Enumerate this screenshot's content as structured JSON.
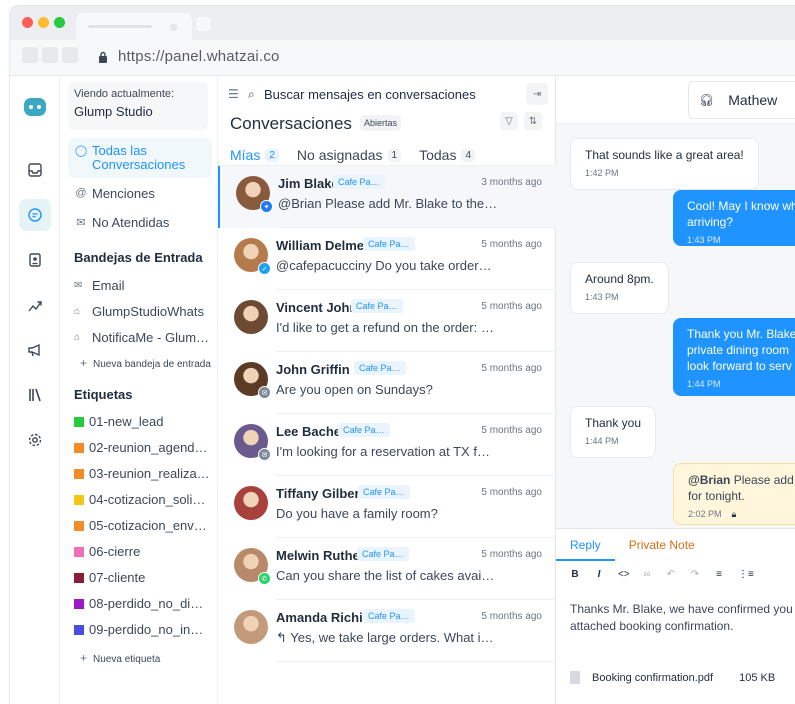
{
  "browser": {
    "url": "https://panel.whatzai.co"
  },
  "sidebar": {
    "viewing_label": "Viendo actualmente:",
    "viewing_value": "Glump Studio",
    "nav": [
      {
        "label": "Todas las Conversaciones",
        "icon": "chat-icon"
      },
      {
        "label": "Menciones",
        "icon": "at-icon"
      },
      {
        "label": "No Atendidas",
        "icon": "envelope-icon"
      }
    ],
    "inboxes_title": "Bandejas de Entrada",
    "inboxes": [
      {
        "label": "Email",
        "icon": "mail-icon"
      },
      {
        "label": "GlumpStudioWhats",
        "icon": "inbox-icon"
      },
      {
        "label": "NotificaMe - Glum…",
        "icon": "inbox-icon"
      }
    ],
    "new_inbox": "Nueva bandeja de entrada",
    "labels_title": "Etiquetas",
    "labels": [
      {
        "label": "01-new_lead",
        "color": "#27c93f"
      },
      {
        "label": "02-reunion_agend…",
        "color": "#f28c28"
      },
      {
        "label": "03-reunion_realiza…",
        "color": "#f28c28"
      },
      {
        "label": "04-cotizacion_soli…",
        "color": "#f5c518"
      },
      {
        "label": "05-cotizacion_env…",
        "color": "#f28c28"
      },
      {
        "label": "06-cierre",
        "color": "#f06eb7"
      },
      {
        "label": "07-cliente",
        "color": "#8b1c3a"
      },
      {
        "label": "08-perdido_no_di…",
        "color": "#9b19c9"
      },
      {
        "label": "09-perdido_no_in…",
        "color": "#4a4de0"
      }
    ],
    "new_label": "Nueva etiqueta"
  },
  "list": {
    "search_placeholder": "Buscar mensajes en conversaciones",
    "title": "Conversaciones",
    "status": "Abiertas",
    "tabs": [
      {
        "label": "Mías",
        "count": "2"
      },
      {
        "label": "No asignadas",
        "count": "1"
      },
      {
        "label": "Todas",
        "count": "4"
      }
    ],
    "conversations": [
      {
        "name": "Jim Blake",
        "tag": "Cafe Pa…",
        "time": "3 months ago",
        "message": "@Brian Please add Mr. Blake to the gu…",
        "channel_icon": "messenger-icon",
        "avatar_color": "#8a5a3c",
        "channel_color": "#1f7cf2"
      },
      {
        "name": "William Delmer",
        "tag": "Cafe Pa…",
        "time": "5 months ago",
        "message": "@cafepacucciny Do you take orders vi…",
        "channel_icon": "twitter-icon",
        "avatar_color": "#b57b4c",
        "channel_color": "#1da1f2"
      },
      {
        "name": "Vincent John",
        "tag": "Cafe Pa…",
        "time": "5 months ago",
        "message": "I'd like to get a refund on the order: 12…",
        "channel_icon": "none",
        "avatar_color": "#6e4a33",
        "channel_color": ""
      },
      {
        "name": "John Griffin",
        "tag": "Cafe Pa…",
        "time": "5 months ago",
        "message": "Are you open on Sundays?",
        "channel_icon": "email-icon",
        "avatar_color": "#5b3b26",
        "channel_color": "#7c8896"
      },
      {
        "name": "Lee Bacher",
        "tag": "Cafe Pa…",
        "time": "5 months ago",
        "message": "I'm looking for a reservation at TX for t…",
        "channel_icon": "email-icon",
        "avatar_color": "#6a5a8e",
        "channel_color": "#7c8896"
      },
      {
        "name": "Tiffany Gilbert",
        "tag": "Cafe Pa…",
        "time": "5 months ago",
        "message": "Do you have a family room?",
        "channel_icon": "none",
        "avatar_color": "#a8413b",
        "channel_color": ""
      },
      {
        "name": "Melwin Ruther",
        "tag": "Cafe Pa…",
        "time": "5 months ago",
        "message": "Can you share the list of cakes availabl…",
        "channel_icon": "whatsapp-icon",
        "avatar_color": "#b88a6a",
        "channel_color": "#25d366"
      },
      {
        "name": "Amanda Richie",
        "tag": "Cafe Pa…",
        "time": "5 months ago",
        "message": "↰ Yes, we take large orders. What is th…",
        "channel_icon": "none",
        "avatar_color": "#c39a7a",
        "channel_color": ""
      }
    ]
  },
  "chat": {
    "agent": "Mathew",
    "messages": [
      {
        "text": "That sounds like a great area!",
        "time": "1:42 PM",
        "type": "in"
      },
      {
        "text": "Cool! May I know wh arriving?",
        "time": "1:43 PM",
        "type": "out"
      },
      {
        "text": "Around 8pm.",
        "time": "1:43 PM",
        "type": "in"
      },
      {
        "text": "Thank you Mr. Blake private dining room look forward to serv",
        "time": "1:44 PM",
        "type": "out"
      },
      {
        "text": "Thank you",
        "time": "1:44 PM",
        "type": "in"
      },
      {
        "mention": "@Brian",
        "text": " Please add for tonight.",
        "time": "2:02 PM",
        "type": "note"
      }
    ],
    "reply_tab": "Reply",
    "note_tab": "Private Note",
    "tools": [
      "B",
      "I",
      "<>",
      "∞",
      "↶",
      "↷",
      "≡",
      "⋮≡"
    ],
    "reply_text": "Thanks Mr. Blake, we have confirmed you attached booking confirmation.",
    "attachment_name": "Booking confirmation.pdf",
    "attachment_size": "105 KB"
  }
}
